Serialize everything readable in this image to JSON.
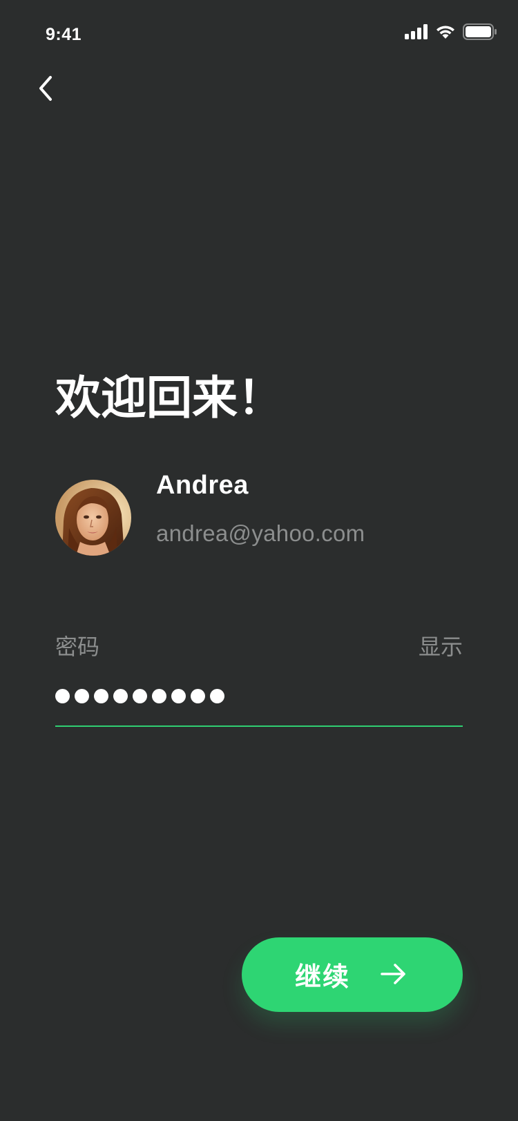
{
  "status_bar": {
    "time": "9:41",
    "icons": [
      "signal-icon",
      "wifi-icon",
      "battery-icon"
    ]
  },
  "nav": {
    "back_icon": "chevron-left-icon"
  },
  "welcome": {
    "title": "欢迎回来！"
  },
  "user": {
    "name": "Andrea",
    "email": "andrea@yahoo.com",
    "avatar_icon": "avatar-photo"
  },
  "password": {
    "label": "密码",
    "show_label": "显示",
    "masked_value": "●●●●●●●●●",
    "length": 9
  },
  "continue_button": {
    "label": "继续",
    "icon": "arrow-right-icon"
  },
  "colors": {
    "background": "#2b2d2d",
    "accent": "#2ed573",
    "muted_text": "#8c8e8e",
    "text": "#ffffff"
  }
}
